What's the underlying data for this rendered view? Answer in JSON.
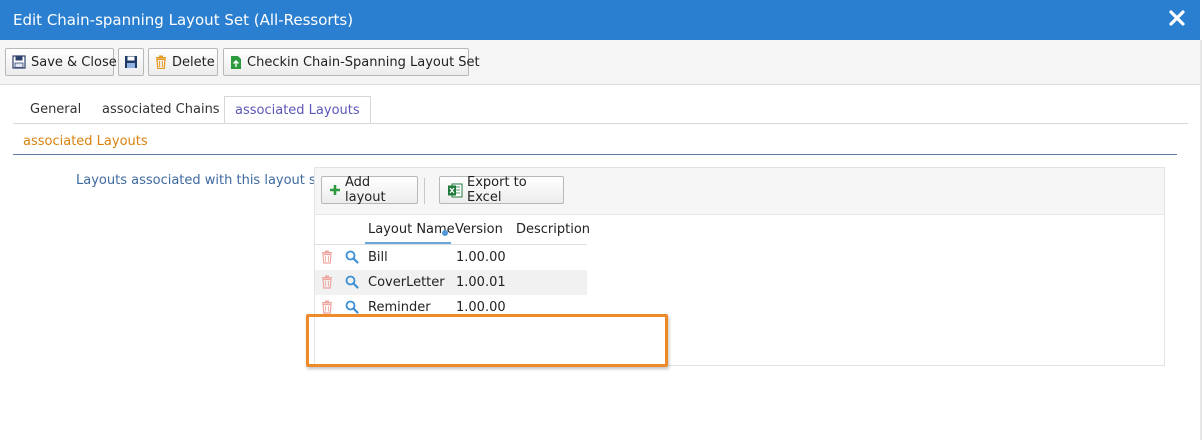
{
  "window": {
    "title": "Edit Chain-spanning Layout Set (All-Ressorts)",
    "close_icon": "close-icon"
  },
  "toolbar": {
    "save_close_label": "Save & Close",
    "save_icon": "floppy-disk-icon",
    "delete_label": "Delete",
    "checkin_label": "Checkin Chain-Spanning Layout Set"
  },
  "tabs": [
    {
      "label": "General",
      "active": false
    },
    {
      "label": "associated Chains",
      "active": false
    },
    {
      "label": "associated Layouts",
      "active": true
    }
  ],
  "section": {
    "title": "associated Layouts",
    "field_label": "Layouts associated with this layout set"
  },
  "grid": {
    "add_label": "Add layout",
    "export_label": "Export to Excel",
    "columns": {
      "name": "Layout Name",
      "version": "Version",
      "description": "Description"
    },
    "rows": [
      {
        "name": "Bill",
        "version": "1.00.00",
        "description": ""
      },
      {
        "name": "CoverLetter",
        "version": "1.00.01",
        "description": ""
      },
      {
        "name": "Reminder",
        "version": "1.00.00",
        "description": ""
      }
    ]
  },
  "colors": {
    "titlebar": "#2a7fd0",
    "active_tab": "#5b57b8",
    "section_title": "#d9820f",
    "highlight_box": "#ef8a2a",
    "label_blue": "#3f6aa0"
  }
}
